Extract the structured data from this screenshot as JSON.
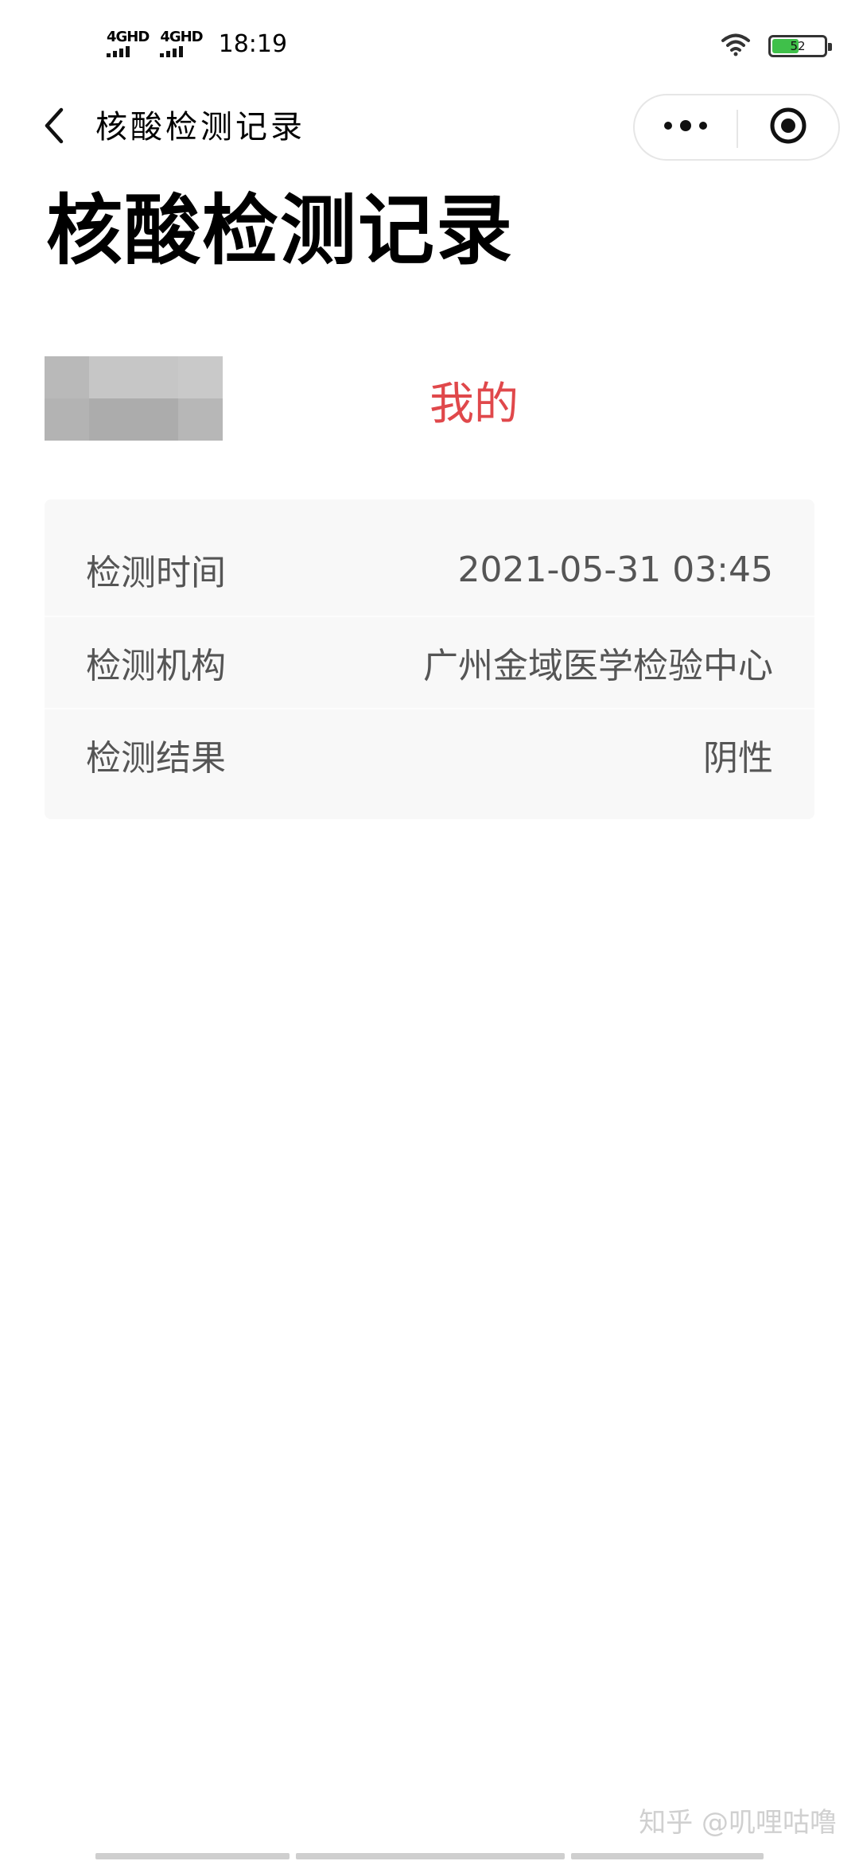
{
  "status_bar": {
    "network_1": "4GHD",
    "network_2": "4GHD",
    "time": "18:19",
    "battery_level": "52",
    "battery_fraction": 0.52,
    "battery_color": "#3fc04a"
  },
  "nav": {
    "back_icon": "chevron-left-icon",
    "title": "核酸检测记录",
    "more_icon": "more-dots-icon",
    "close_icon": "target-circle-icon"
  },
  "page": {
    "title": "核酸检测记录",
    "owner_label": "我的",
    "owner_label_color": "#e0484b"
  },
  "record": {
    "rows": [
      {
        "label": "检测时间",
        "value": "2021-05-31 03:45"
      },
      {
        "label": "检测机构",
        "value": "广州金域医学检验中心"
      },
      {
        "label": "检测结果",
        "value": "阴性"
      }
    ]
  },
  "watermark": "知乎 @叽哩咕噜"
}
